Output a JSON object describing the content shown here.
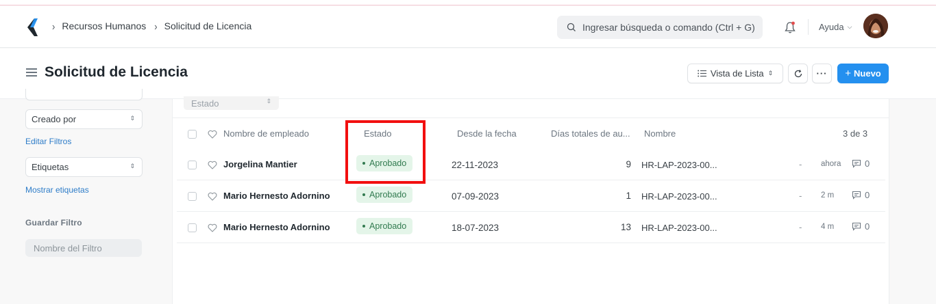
{
  "breadcrumbs": [
    "Recursos Humanos",
    "Solicitud de Licencia"
  ],
  "search": {
    "placeholder": "Ingresar búsqueda o comando (Ctrl + G)"
  },
  "help_label": "Ayuda",
  "page": {
    "title": "Solicitud de Licencia",
    "view_label": "Vista de Lista",
    "new_label": "Nuevo"
  },
  "sidebar": {
    "created_by": "Creado por",
    "edit_filters": "Editar Filtros",
    "tags": "Etiquetas",
    "show_tags": "Mostrar etiquetas",
    "save_filter_title": "Guardar Filtro",
    "filter_name_placeholder": "Nombre del Filtro"
  },
  "filters": {
    "estado_placeholder": "Estado"
  },
  "table": {
    "columns": {
      "employee": "Nombre de empleado",
      "status": "Estado",
      "from_date": "Desde la fecha",
      "total_days": "Días totales de au...",
      "name": "Nombre"
    },
    "count": "3 de 3",
    "rows": [
      {
        "employee": "Jorgelina Mantier",
        "status": "Aprobado",
        "from_date": "22-11-2023",
        "days": "9",
        "name": "HR-LAP-2023-00...",
        "dash": "-",
        "time": "ahora",
        "comments": "0"
      },
      {
        "employee": "Mario Hernesto Adornino",
        "status": "Aprobado",
        "from_date": "07-09-2023",
        "days": "1",
        "name": "HR-LAP-2023-00...",
        "dash": "-",
        "time": "2 m",
        "comments": "0"
      },
      {
        "employee": "Mario Hernesto Adornino",
        "status": "Aprobado",
        "from_date": "18-07-2023",
        "days": "13",
        "name": "HR-LAP-2023-00...",
        "dash": "-",
        "time": "4 m",
        "comments": "0"
      }
    ]
  },
  "colors": {
    "primary": "#2490ef",
    "approved_bg": "#e4f5e9",
    "approved_text": "#317a4f",
    "highlight": "#f20f0f",
    "link": "#2d7cc8"
  }
}
